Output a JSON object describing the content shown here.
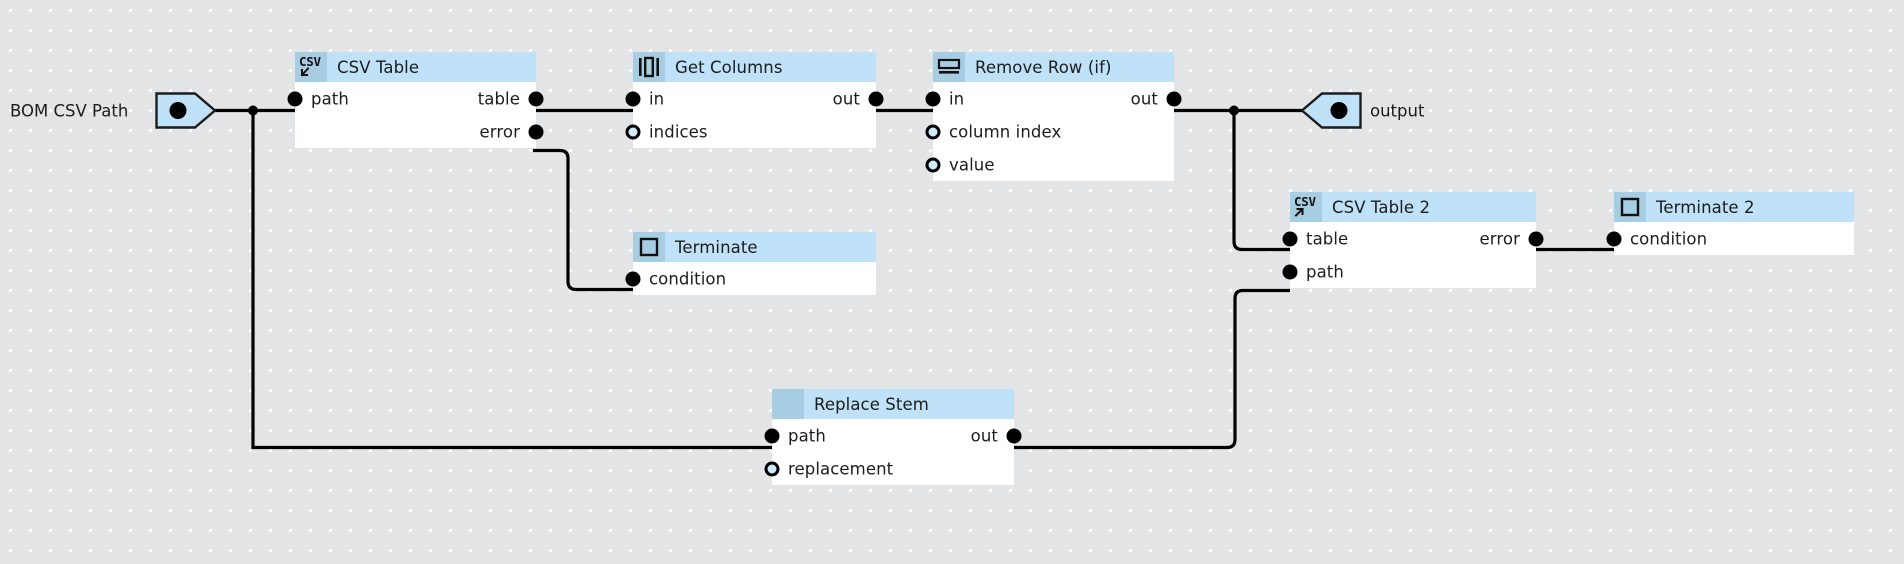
{
  "graph": {
    "title": "node-graph-canvas",
    "background_color": "#e2e4e6",
    "grid_dot_color": "#ffffff",
    "node_header_color": "#bfe2f9",
    "node_icon_color": "#a7cde2",
    "node_body_color": "#ffffff",
    "wire_color": "#000000",
    "port_fill_color": "#000000",
    "port_optional_fill": "#cfeaf8"
  },
  "terminals": [
    {
      "id": "input-terminal",
      "label": "BOM CSV Path",
      "kind": "input",
      "icon": "input-pin-icon"
    },
    {
      "id": "output-terminal",
      "label": "output",
      "kind": "output",
      "icon": "output-pin-icon"
    }
  ],
  "nodes": [
    {
      "id": "csv-table",
      "title": "CSV Table",
      "icon": "csv-import-icon",
      "inputs": [
        {
          "name": "path",
          "connected": true
        }
      ],
      "outputs": [
        {
          "name": "table",
          "connected": true
        },
        {
          "name": "error",
          "connected": true
        }
      ]
    },
    {
      "id": "get-columns",
      "title": "Get Columns",
      "icon": "columns-icon",
      "inputs": [
        {
          "name": "in",
          "connected": true
        },
        {
          "name": "indices",
          "connected": false
        }
      ],
      "outputs": [
        {
          "name": "out",
          "connected": true
        }
      ]
    },
    {
      "id": "remove-row-if",
      "title": "Remove Row (if)",
      "icon": "rows-icon",
      "inputs": [
        {
          "name": "in",
          "connected": true
        },
        {
          "name": "column index",
          "connected": false
        },
        {
          "name": "value",
          "connected": false
        }
      ],
      "outputs": [
        {
          "name": "out",
          "connected": true
        }
      ]
    },
    {
      "id": "terminate",
      "title": "Terminate",
      "icon": "stop-square-icon",
      "inputs": [
        {
          "name": "condition",
          "connected": true
        }
      ],
      "outputs": []
    },
    {
      "id": "csv-table-2",
      "title": "CSV Table 2",
      "icon": "csv-export-icon",
      "inputs": [
        {
          "name": "table",
          "connected": true
        },
        {
          "name": "path",
          "connected": true
        }
      ],
      "outputs": [
        {
          "name": "error",
          "connected": true
        }
      ]
    },
    {
      "id": "terminate-2",
      "title": "Terminate 2",
      "icon": "stop-square-icon",
      "inputs": [
        {
          "name": "condition",
          "connected": true
        }
      ],
      "outputs": []
    },
    {
      "id": "replace-stem",
      "title": "Replace Stem",
      "icon": "blank-icon",
      "inputs": [
        {
          "name": "path",
          "connected": true
        },
        {
          "name": "replacement",
          "connected": false
        }
      ],
      "outputs": [
        {
          "name": "out",
          "connected": true
        }
      ]
    }
  ],
  "connections": [
    {
      "from": "input-terminal",
      "to": "csv-table.path"
    },
    {
      "from": "input-terminal",
      "to": "replace-stem.path"
    },
    {
      "from": "csv-table.table",
      "to": "get-columns.in"
    },
    {
      "from": "csv-table.error",
      "to": "terminate.condition"
    },
    {
      "from": "get-columns.out",
      "to": "remove-row-if.in"
    },
    {
      "from": "remove-row-if.out",
      "to": "output-terminal"
    },
    {
      "from": "remove-row-if.out",
      "to": "csv-table-2.table"
    },
    {
      "from": "replace-stem.out",
      "to": "csv-table-2.path"
    },
    {
      "from": "csv-table-2.error",
      "to": "terminate-2.condition"
    }
  ]
}
